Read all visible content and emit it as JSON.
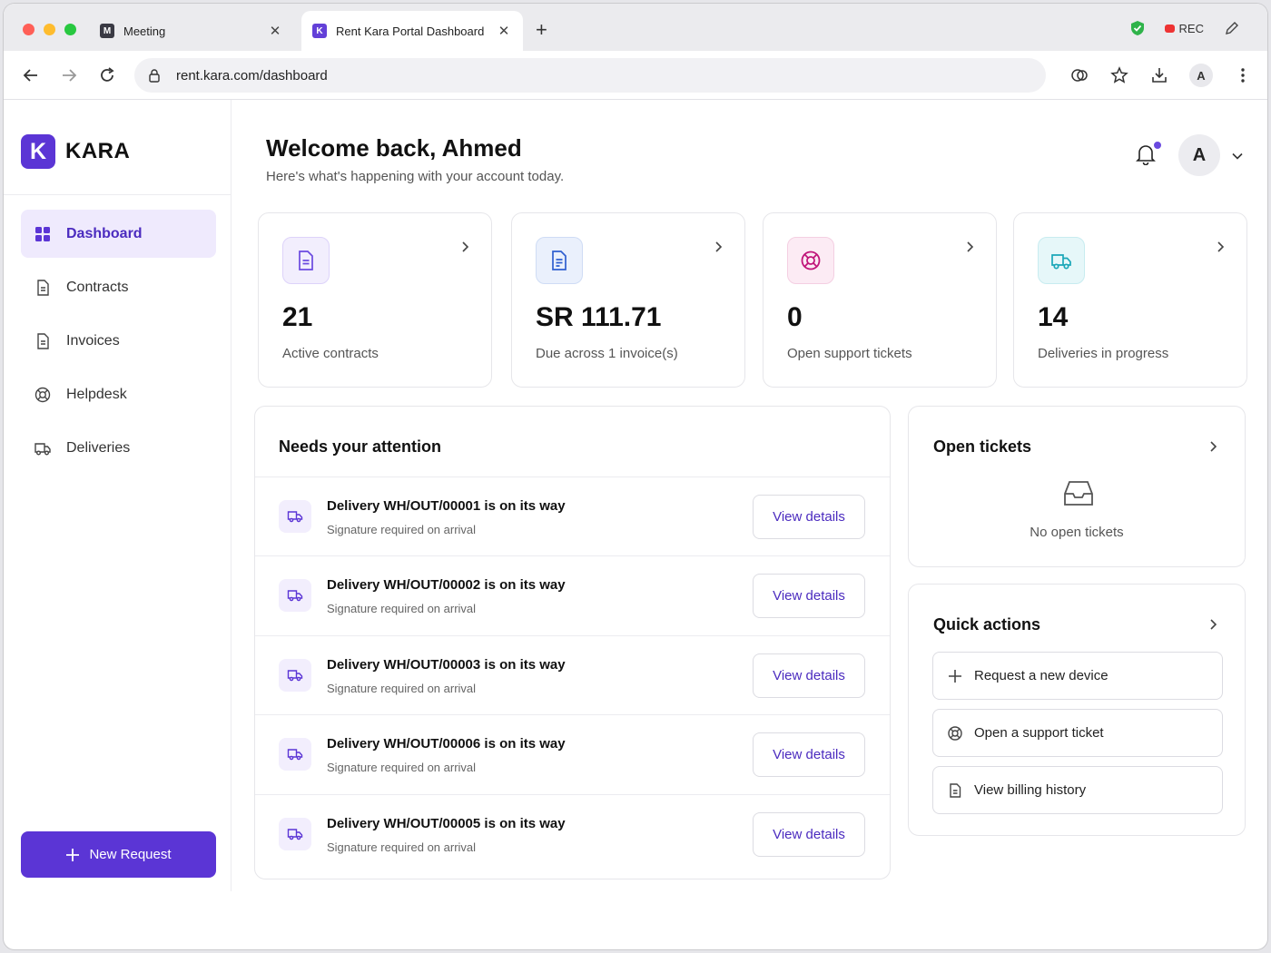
{
  "browser": {
    "tabs": [
      {
        "title": "Meeting",
        "favicon": "M",
        "active": false
      },
      {
        "title": "Rent Kara Portal Dashboard",
        "favicon": "K",
        "active": true
      }
    ],
    "rec_label": "REC",
    "url": "rent.kara.com/dashboard",
    "profile_initial": "A"
  },
  "sidebar": {
    "brand_letter": "K",
    "brand_name": "KARA",
    "items": [
      {
        "label": "Dashboard",
        "icon": "grid-icon",
        "active": true
      },
      {
        "label": "Contracts",
        "icon": "document-icon",
        "active": false
      },
      {
        "label": "Invoices",
        "icon": "document-icon",
        "active": false
      },
      {
        "label": "Helpdesk",
        "icon": "lifebuoy-icon",
        "active": false
      },
      {
        "label": "Deliveries",
        "icon": "truck-icon",
        "active": false
      }
    ],
    "new_request_label": "New Request"
  },
  "header": {
    "title": "Welcome back, Ahmed",
    "subtitle": "Here's what's happening with your account today.",
    "avatar_initial": "A"
  },
  "stats": [
    {
      "value": "21",
      "label": "Active contracts",
      "icon": "document-icon",
      "color": "#6b4ae0"
    },
    {
      "value": "SR 111.71",
      "label": "Due across 1 invoice(s)",
      "icon": "invoice-icon",
      "color": "#2f5fd0"
    },
    {
      "value": "0",
      "label": "Open support tickets",
      "icon": "lifebuoy-icon",
      "color": "#c0157a"
    },
    {
      "value": "14",
      "label": "Deliveries in progress",
      "icon": "truck-icon",
      "color": "#1aa7b8"
    }
  ],
  "attention": {
    "title": "Needs your attention",
    "button_label": "View details",
    "items": [
      {
        "title": "Delivery WH/OUT/00001 is on its way",
        "subtitle": "Signature required on arrival"
      },
      {
        "title": "Delivery WH/OUT/00002 is on its way",
        "subtitle": "Signature required on arrival"
      },
      {
        "title": "Delivery WH/OUT/00003 is on its way",
        "subtitle": "Signature required on arrival"
      },
      {
        "title": "Delivery WH/OUT/00006 is on its way",
        "subtitle": "Signature required on arrival"
      },
      {
        "title": "Delivery WH/OUT/00005 is on its way",
        "subtitle": "Signature required on arrival"
      }
    ]
  },
  "tickets": {
    "title": "Open tickets",
    "empty_text": "No open tickets"
  },
  "quick_actions": {
    "title": "Quick actions",
    "items": [
      {
        "label": "Request a new device",
        "icon": "plus-icon"
      },
      {
        "label": "Open a support ticket",
        "icon": "lifebuoy-icon"
      },
      {
        "label": "View billing history",
        "icon": "document-icon"
      }
    ]
  },
  "colors": {
    "brand": "#5b35d5",
    "active_nav_bg": "#efeafd"
  }
}
